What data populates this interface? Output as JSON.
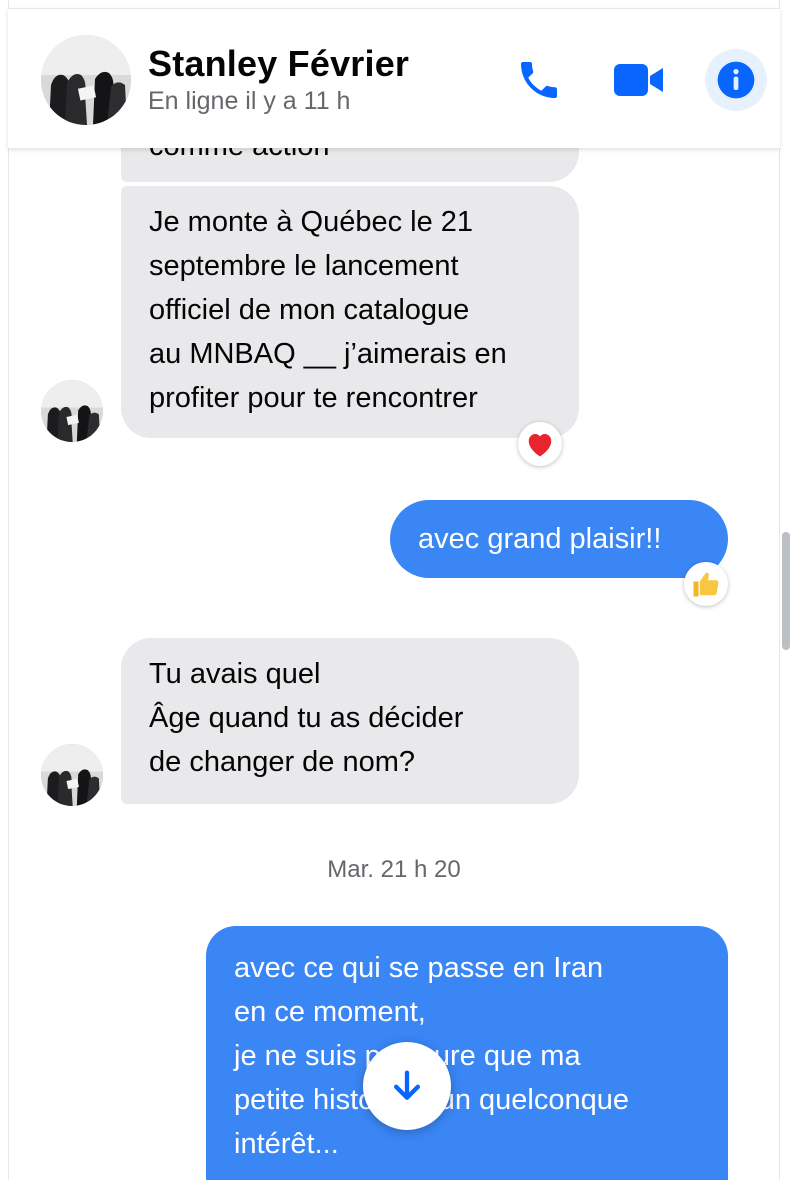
{
  "header": {
    "contact_name": "Stanley Février",
    "status": "En ligne il y a 11 h",
    "actions": [
      {
        "icon": "phone-icon",
        "label": "Call"
      },
      {
        "icon": "video-camera-icon",
        "label": "Video call"
      },
      {
        "icon": "info-icon",
        "label": "Conversation information"
      }
    ]
  },
  "colors": {
    "accent": "#0866ff",
    "outgoing_bubble": "#3a86f5",
    "incoming_bubble": "#e9e9eb",
    "secondary_text": "#65676b"
  },
  "messages": [
    {
      "direction": "in",
      "lines": [
        "comme action"
      ],
      "partially_hidden": true
    },
    {
      "direction": "in",
      "lines": [
        "Je monte à Québec le 21",
        "septembre le lancement",
        "officiel de mon catalogue",
        "au MNBAQ __ j’aimerais en",
        "profiter pour te rencontrer"
      ],
      "reaction": "red-heart"
    },
    {
      "direction": "out",
      "lines": [
        "avec grand plaisir!!"
      ],
      "reaction": "thumbs-up"
    },
    {
      "direction": "in",
      "lines": [
        "Tu avais quel",
        "Âge quand tu as décider",
        "de changer de nom?"
      ]
    },
    {
      "type": "timestamp",
      "text": "Mar. 21 h 20"
    },
    {
      "direction": "out",
      "lines": [
        "avec ce qui se passe en Iran",
        "en ce moment,",
        "je ne suis pas sure que ma",
        "petite histoire a un quelconque",
        "intérêt..."
      ],
      "partially_hidden": true
    }
  ],
  "scroll_down_button": {
    "icon": "arrow-down-icon"
  }
}
